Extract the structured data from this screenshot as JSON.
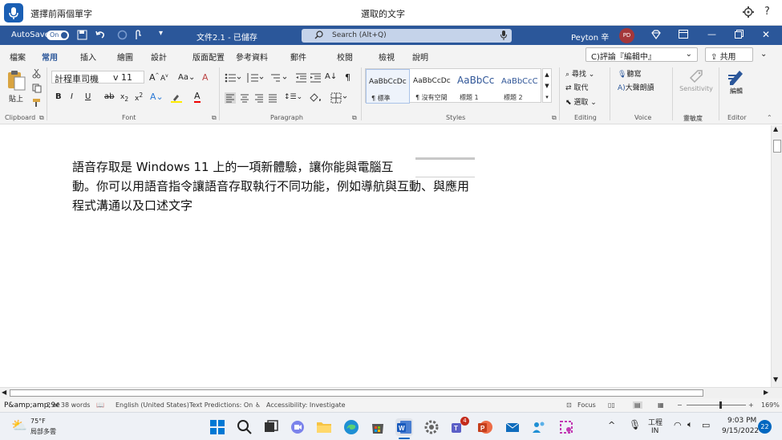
{
  "voice_access": {
    "title": "選擇前兩個單字",
    "center_text": "選取的文字",
    "help": "?"
  },
  "title_bar": {
    "autosave_label": "AutoSave",
    "autosave_state": "On",
    "doc_title": "文件2.1 - 已儲存",
    "search_placeholder": "Search (Alt+Q)",
    "user_name": "Peyton 辛",
    "user_initials": "PD"
  },
  "menu": {
    "tabs": [
      "檔案",
      "常用",
      "插入",
      "繪圖",
      "設計",
      "版面配置",
      "參考資料",
      "郵件",
      "校閱",
      "檢視",
      "說明"
    ],
    "active_tab": "常用",
    "comment_button": "C)評論『編輯中』",
    "share_button": "共用"
  },
  "ribbon": {
    "clipboard": {
      "paste": "貼上",
      "group_label": "Clipboard"
    },
    "font": {
      "name": "計程車司機",
      "size": "v 11",
      "group_label": "Font"
    },
    "paragraph": {
      "group_label": "Paragraph"
    },
    "styles": {
      "group_label": "Styles",
      "items": [
        {
          "sample": "AaBbCcDc",
          "name": "¶ 標準"
        },
        {
          "sample": "AaBbCcDc",
          "name": "¶ 沒有空間"
        },
        {
          "sample": "AaBbCc",
          "name": "標題 1"
        },
        {
          "sample": "AaBbCcC",
          "name": "標題 2"
        }
      ]
    },
    "editing": {
      "find": "尋找",
      "replace": "取代",
      "select": "選取",
      "group_label": "Editing"
    },
    "voice": {
      "dictate": "聽寫",
      "read_aloud": "大聲朗讀",
      "group_label": "Voice"
    },
    "sensitivity": {
      "label": "Sensitivity",
      "group_label": "靈敏度"
    },
    "editor": {
      "label": "編輯",
      "group_label": "Editor"
    }
  },
  "document": {
    "lines": [
      "語音存取是 Windows  11 上的一項新體驗，讓你能與電腦互",
      "動。你可以用語音指令讓語音存取執行不同功能，例如導航與互動、與應用",
      "程式溝通以及口述文字"
    ]
  },
  "status_bar": {
    "page": "P&amp;amp;9e",
    "words": "2 of 38 words",
    "language": "English (United States)",
    "predictions": "Text Predictions: On",
    "accessibility": "Accessibility: Investigate",
    "focus": "Focus",
    "zoom": "169%"
  },
  "taskbar": {
    "weather_temp": "75°F",
    "weather_desc": "局部多雲",
    "teams_badge": "4",
    "input_lang_top": "工程",
    "input_lang_bottom": "IN",
    "time": "9:03 PM",
    "date": "9/15/2022",
    "notification_count": "22"
  }
}
